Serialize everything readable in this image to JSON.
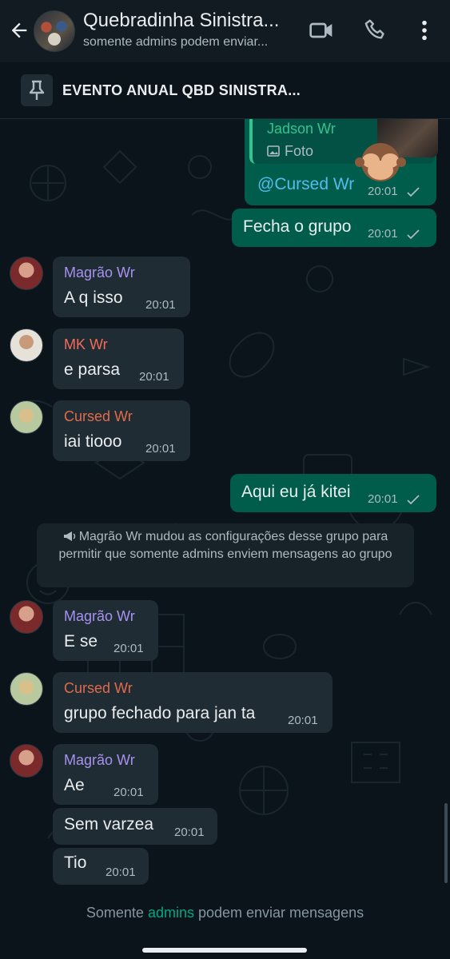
{
  "header": {
    "title": "Quebradinha Sinistra...",
    "subtitle": "somente admins podem enviar...",
    "icons": [
      "back-arrow-icon",
      "video-call-icon",
      "voice-call-icon",
      "more-options-icon"
    ]
  },
  "pinned": {
    "text": "EVENTO ANUAL QBD SINISTRA..."
  },
  "messages": [
    {
      "sender": "Jadson Wr",
      "attachment_label": "Foto",
      "text": "@Cursed Wr",
      "time": "20:01"
    },
    {
      "text": "Fecha o grupo",
      "time": "20:01"
    },
    {
      "sender": "Magrão Wr",
      "text": "A q isso",
      "time": "20:01"
    },
    {
      "sender": "MK Wr",
      "text": "e parsa",
      "time": "20:01"
    },
    {
      "sender": "Cursed Wr",
      "text": "iai tiooo",
      "time": "20:01"
    },
    {
      "text": "Aqui eu já kitei",
      "time": "20:01"
    },
    {
      "sender": "Magrão Wr",
      "text": "E se",
      "time": "20:01"
    },
    {
      "sender": "Cursed Wr",
      "text": "grupo fechado para jan ta",
      "time": "20:01"
    },
    {
      "sender": "Magrão Wr",
      "text": "Ae",
      "time": "20:01"
    },
    {
      "text": "Sem varzea",
      "time": "20:01"
    },
    {
      "text": "Tio",
      "time": "20:01"
    }
  ],
  "system_message": {
    "icon": "megaphone-icon",
    "text": "Magrão Wr mudou as configurações desse grupo para permitir que somente admins enviem mensagens ao grupo"
  },
  "footer": {
    "prefix": "Somente ",
    "highlight": "admins",
    "suffix": " podem enviar mensagens"
  },
  "colors": {
    "background": "#0b141a",
    "outgoing_bubble": "#005c4b",
    "incoming_bubble": "#202c33",
    "accent": "#00a884",
    "sender_magrao": "#a791f0",
    "sender_mk": "#f56b5b",
    "sender_cursed": "#e26a4a",
    "sender_jadson": "#35c48e"
  }
}
